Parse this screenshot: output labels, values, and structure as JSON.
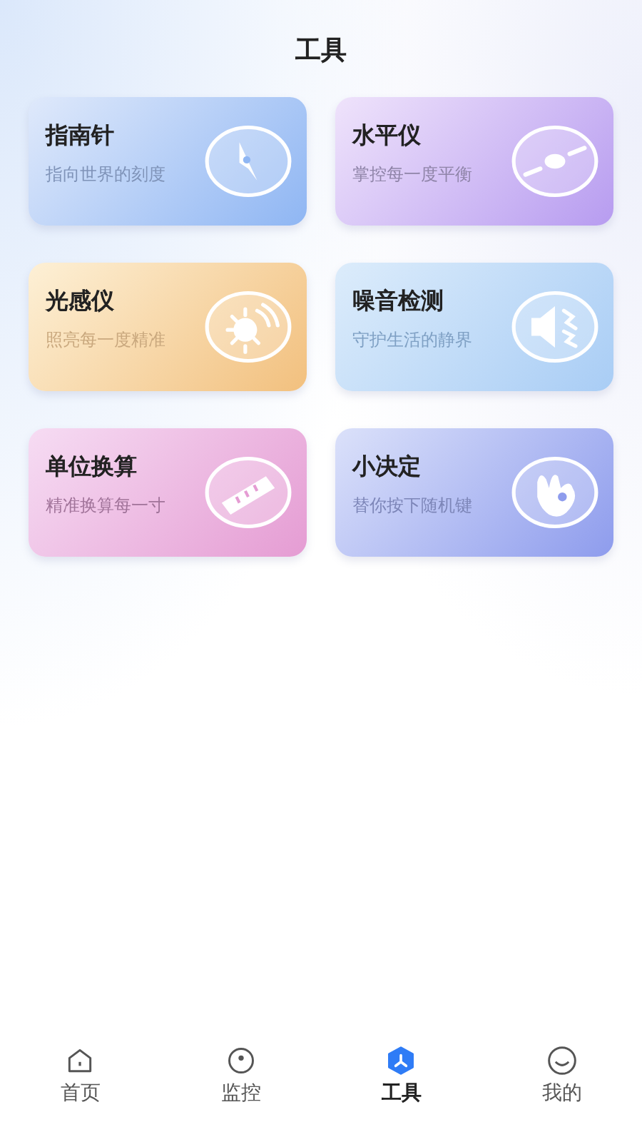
{
  "title": "工具",
  "tools": [
    {
      "kind": "compass",
      "name": "指南针",
      "desc": "指向世界的刻度"
    },
    {
      "kind": "level",
      "name": "水平仪",
      "desc": "掌控每一度平衡"
    },
    {
      "kind": "light",
      "name": "光感仪",
      "desc": "照亮每一度精准"
    },
    {
      "kind": "noise",
      "name": "噪音检测",
      "desc": "守护生活的静界"
    },
    {
      "kind": "ruler",
      "name": "单位换算",
      "desc": "精准换算每一寸"
    },
    {
      "kind": "hand",
      "name": "小决定",
      "desc": "替你按下随机键"
    }
  ],
  "tabs": [
    {
      "kind": "home",
      "label": "首页",
      "selected": false
    },
    {
      "kind": "monitor",
      "label": "监控",
      "selected": false
    },
    {
      "kind": "tools",
      "label": "工具",
      "selected": true
    },
    {
      "kind": "me",
      "label": "我的",
      "selected": false
    }
  ]
}
